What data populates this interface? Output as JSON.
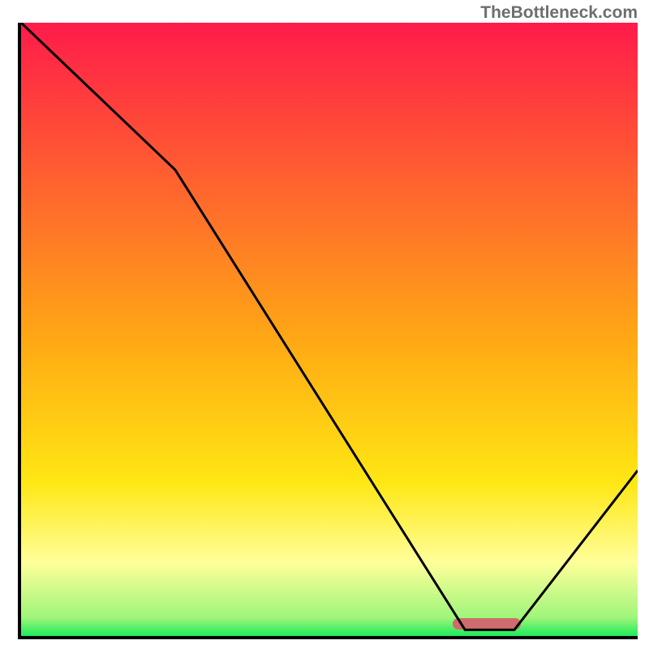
{
  "watermark": "TheBottleneck.com",
  "colors": {
    "top": "#ff1b4a",
    "mid1": "#ff8a2a",
    "mid2": "#ffe714",
    "pale": "#ffff9a",
    "green": "#1eea5a",
    "border": "#000000",
    "curve": "#000000",
    "marker": "#cf6b6e"
  },
  "chart_data": {
    "type": "line",
    "title": "",
    "xlabel": "",
    "ylabel": "",
    "xlim": [
      0,
      100
    ],
    "ylim": [
      0,
      100
    ],
    "x": [
      0,
      25,
      72,
      80,
      100
    ],
    "values": [
      100,
      76,
      1,
      1,
      27
    ],
    "grid": false,
    "legend": false,
    "marker_range_x": [
      70,
      81
    ],
    "marker_y": 2,
    "gradient_stops": [
      {
        "pos": 0,
        "color": "#ff1b4a"
      },
      {
        "pos": 52,
        "color": "#ffa914"
      },
      {
        "pos": 75,
        "color": "#ffe714"
      },
      {
        "pos": 88,
        "color": "#ffff9a"
      },
      {
        "pos": 97,
        "color": "#9ff57a"
      },
      {
        "pos": 100,
        "color": "#1eea5a"
      }
    ]
  }
}
